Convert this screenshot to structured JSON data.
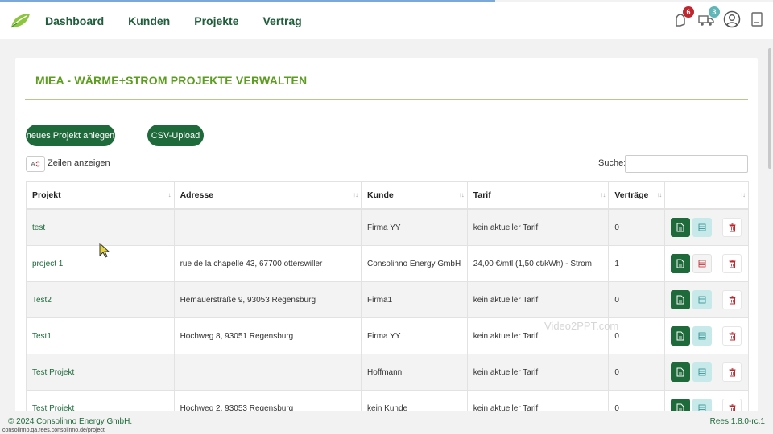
{
  "nav": {
    "links": [
      "Dashboard",
      "Kunden",
      "Projekte",
      "Vertrag"
    ],
    "notification_count": "6",
    "task_count": "3"
  },
  "page": {
    "title": "MIEA - WÄRME+STROM PROJEKTE VERWALTEN",
    "new_project_button": "neues Projekt anlegen",
    "csv_button": "CSV-Upload",
    "rows_select_value": "A",
    "rows_label": "Zeilen anzeigen",
    "search_label": "Suche:"
  },
  "table": {
    "headers": [
      "Projekt",
      "Adresse",
      "Kunde",
      "Tarif",
      "Verträge"
    ],
    "sort_icon": "↑↓",
    "rows": [
      {
        "projekt": "test",
        "adresse": "",
        "kunde": "Firma YY",
        "tarif": "kein aktueller Tarif",
        "vertraege": "0"
      },
      {
        "projekt": "project 1",
        "adresse": "rue de la chapelle 43, 67700 otterswiller",
        "kunde": "Consolinno Energy GmbH",
        "tarif": "24,00 €/mtl (1,50 ct/kWh) - Strom",
        "vertraege": "1"
      },
      {
        "projekt": "Test2",
        "adresse": "Hemauerstraße 9, 93053 Regensburg",
        "kunde": "Firma1",
        "tarif": "kein aktueller Tarif",
        "vertraege": "0"
      },
      {
        "projekt": "Test1",
        "adresse": "Hochweg 8, 93051 Regensburg",
        "kunde": "Firma YY",
        "tarif": "kein aktueller Tarif",
        "vertraege": "0"
      },
      {
        "projekt": "Test Projekt",
        "adresse": "",
        "kunde": "Hoffmann",
        "tarif": "kein aktueller Tarif",
        "vertraege": "0"
      },
      {
        "projekt": "Test Projekt",
        "adresse": "Hochweg 2, 93053 Regensburg",
        "kunde": "kein Kunde",
        "tarif": "kein aktueller Tarif",
        "vertraege": "0"
      }
    ]
  },
  "footer": {
    "copyright": "© 2024 Consolinno Energy GmbH.",
    "version": "Rees 1.8.0-rc.1",
    "status_url": "consolinno.qa.rees.consolinno.de/project"
  },
  "watermark": "Video2PPT.com",
  "colors": {
    "primary_green": "#1f6a3b",
    "title_green": "#5c9c1f",
    "badge_red": "#c0262d",
    "badge_teal": "#5fb6b8",
    "teal_button": "#c7e9ea"
  }
}
